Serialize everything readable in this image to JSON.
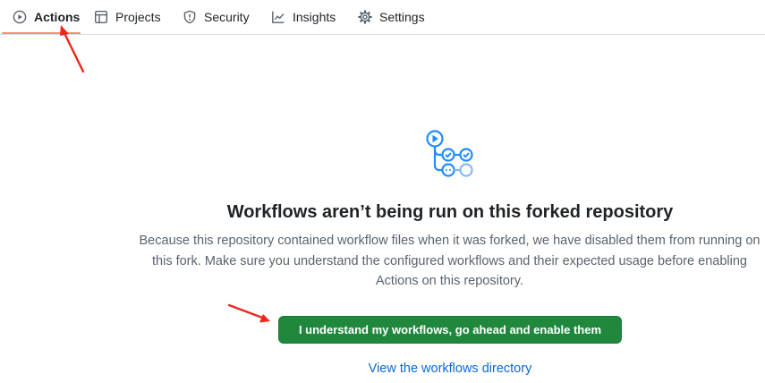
{
  "tabs": [
    {
      "label": "Actions",
      "icon": "play-circle-icon",
      "active": true
    },
    {
      "label": "Projects",
      "icon": "table-icon",
      "active": false
    },
    {
      "label": "Security",
      "icon": "shield-icon",
      "active": false
    },
    {
      "label": "Insights",
      "icon": "graph-icon",
      "active": false
    },
    {
      "label": "Settings",
      "icon": "gear-icon",
      "active": false
    }
  ],
  "main": {
    "icon": "workflow-icon",
    "title": "Workflows aren’t being run on this forked repository",
    "description": "Because this repository contained workflow files when it was forked, we have disabled them from running on this fork. Make sure you understand the configured workflows and their expected usage before enabling Actions on this repository.",
    "enable_button": "I understand my workflows, go ahead and enable them",
    "directory_link": "View the workflows directory"
  },
  "colors": {
    "accent_underline": "#fd8c73",
    "button_green": "#1f883d",
    "link_blue": "#0969da",
    "annotation_red": "#e8291c",
    "workflow_blue": "#218bff"
  }
}
